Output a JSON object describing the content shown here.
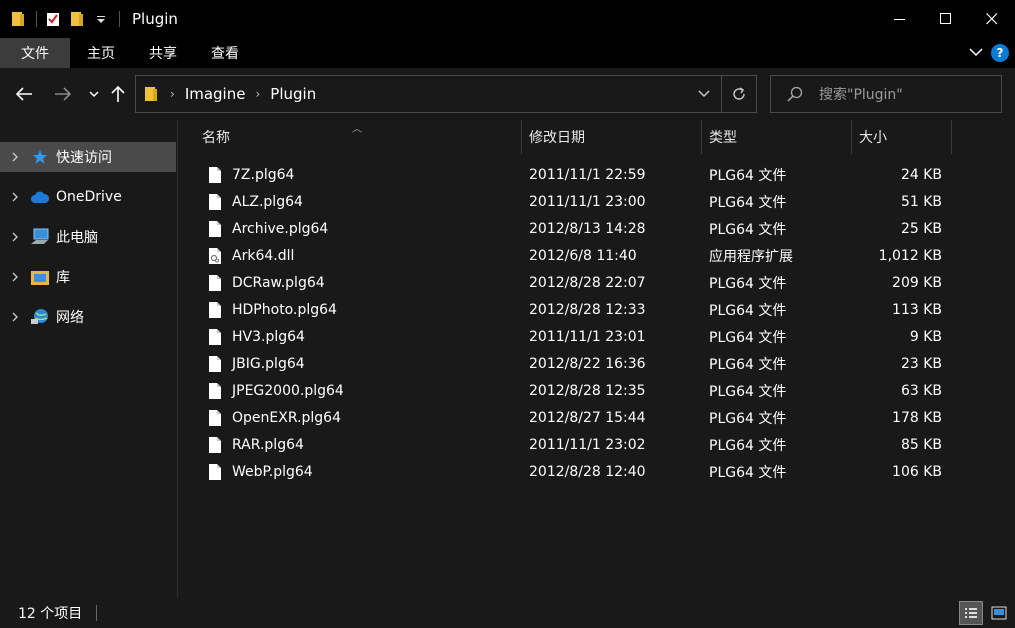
{
  "window": {
    "title": "Plugin",
    "minimize_glyph": "—",
    "maximize_glyph": "☐",
    "close_glyph": "✕"
  },
  "ribbon": {
    "tabs": [
      {
        "label": "文件"
      },
      {
        "label": "主页"
      },
      {
        "label": "共享"
      },
      {
        "label": "查看"
      }
    ],
    "help": "?"
  },
  "address": {
    "crumbs": [
      "Imagine",
      "Plugin"
    ],
    "search_placeholder": "搜索\"Plugin\""
  },
  "sidebar": {
    "items": [
      {
        "label": "快速访问",
        "icon": "star-icon"
      },
      {
        "label": "OneDrive",
        "icon": "cloud-icon"
      },
      {
        "label": "此电脑",
        "icon": "computer-icon"
      },
      {
        "label": "库",
        "icon": "library-icon"
      },
      {
        "label": "网络",
        "icon": "network-icon"
      }
    ]
  },
  "columns": {
    "name": "名称",
    "date": "修改日期",
    "type": "类型",
    "size": "大小"
  },
  "files": [
    {
      "name": "7Z.plg64",
      "date": "2011/11/1 22:59",
      "type": "PLG64 文件",
      "size": "24 KB",
      "icon": "file-icon"
    },
    {
      "name": "ALZ.plg64",
      "date": "2011/11/1 23:00",
      "type": "PLG64 文件",
      "size": "51 KB",
      "icon": "file-icon"
    },
    {
      "name": "Archive.plg64",
      "date": "2012/8/13 14:28",
      "type": "PLG64 文件",
      "size": "25 KB",
      "icon": "file-icon"
    },
    {
      "name": "Ark64.dll",
      "date": "2012/6/8 11:40",
      "type": "应用程序扩展",
      "size": "1,012 KB",
      "icon": "dll-icon"
    },
    {
      "name": "DCRaw.plg64",
      "date": "2012/8/28 22:07",
      "type": "PLG64 文件",
      "size": "209 KB",
      "icon": "file-icon"
    },
    {
      "name": "HDPhoto.plg64",
      "date": "2012/8/28 12:33",
      "type": "PLG64 文件",
      "size": "113 KB",
      "icon": "file-icon"
    },
    {
      "name": "HV3.plg64",
      "date": "2011/11/1 23:01",
      "type": "PLG64 文件",
      "size": "9 KB",
      "icon": "file-icon"
    },
    {
      "name": "JBIG.plg64",
      "date": "2012/8/22 16:36",
      "type": "PLG64 文件",
      "size": "23 KB",
      "icon": "file-icon"
    },
    {
      "name": "JPEG2000.plg64",
      "date": "2012/8/28 12:35",
      "type": "PLG64 文件",
      "size": "63 KB",
      "icon": "file-icon"
    },
    {
      "name": "OpenEXR.plg64",
      "date": "2012/8/27 15:44",
      "type": "PLG64 文件",
      "size": "178 KB",
      "icon": "file-icon"
    },
    {
      "name": "RAR.plg64",
      "date": "2011/11/1 23:02",
      "type": "PLG64 文件",
      "size": "85 KB",
      "icon": "file-icon"
    },
    {
      "name": "WebP.plg64",
      "date": "2012/8/28 12:40",
      "type": "PLG64 文件",
      "size": "106 KB",
      "icon": "file-icon"
    }
  ],
  "status": {
    "count": "12 个项目"
  },
  "colors": {
    "background": "#191919",
    "titlebar": "#000000",
    "selected": "#4a4a4a",
    "accent": "#0a7bd6"
  }
}
